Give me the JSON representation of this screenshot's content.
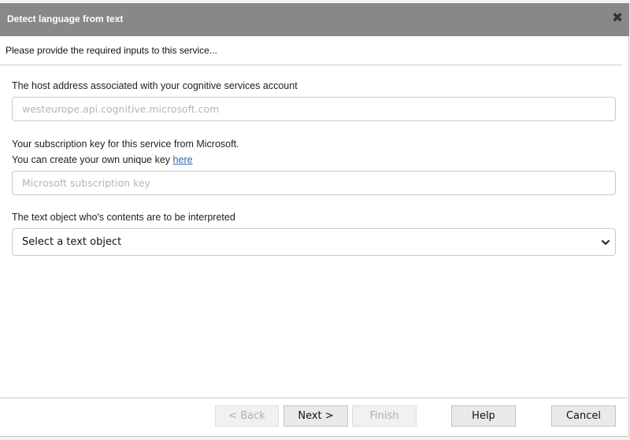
{
  "dialog": {
    "title": "Detect language from text",
    "close_glyph": "✖",
    "intro": "Please provide the required inputs to this service..."
  },
  "host": {
    "label": "The host address associated with your cognitive services account",
    "placeholder": "westeurope.api.cognitive.microsoft.com",
    "value": ""
  },
  "key": {
    "label_line1": "Your subscription key for this service from Microsoft.",
    "label_line2_prefix": "You can create your own unique key ",
    "link_text": "here",
    "placeholder": "Microsoft subscription key",
    "value": ""
  },
  "text_object": {
    "label": "The text object who's contents are to be interpreted",
    "selected": "Select a text object"
  },
  "buttons": {
    "back": "< Back",
    "next": "Next >",
    "finish": "Finish",
    "help": "Help",
    "cancel": "Cancel"
  },
  "icons": {
    "close": "close-icon",
    "dropdown": "chevron-down-icon"
  },
  "colors": {
    "titlebar": "#888888",
    "link": "#2a6aa8"
  }
}
